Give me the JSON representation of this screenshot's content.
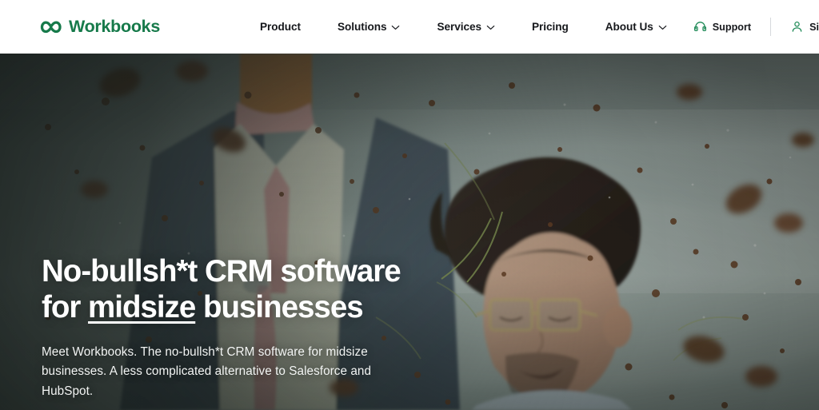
{
  "header": {
    "brand": {
      "name": "Workbooks",
      "mark_icon": "workbooks-infinity-logo-icon",
      "color": "#167a4a"
    },
    "nav": [
      {
        "label": "Product",
        "has_dropdown": false,
        "icon": ""
      },
      {
        "label": "Solutions",
        "has_dropdown": true,
        "icon": "chevron-down-icon"
      },
      {
        "label": "Services",
        "has_dropdown": true,
        "icon": "chevron-down-icon"
      },
      {
        "label": "Pricing",
        "has_dropdown": false,
        "icon": ""
      },
      {
        "label": "About Us",
        "has_dropdown": true,
        "icon": "chevron-down-icon"
      }
    ],
    "utilities": [
      {
        "label": "Support",
        "icon": "headset-icon"
      },
      {
        "label": "Sign In",
        "icon": "user-person-icon"
      }
    ]
  },
  "hero": {
    "title_line1": "No-bullsh*t CRM software",
    "title_line2_prefix": "for ",
    "title_line2_underlined": "midsize",
    "title_line2_suffix": " businesses",
    "subtitle": "Meet Workbooks. The no-bullsh*t CRM software for midsize businesses. A less complicated alternative to Salesforce and HubSpot.",
    "background_description": "Two people in business attire lying on the ground being splattered with flying dirt and soil against a pale grey-green wall",
    "text_color": "#ffffff"
  }
}
